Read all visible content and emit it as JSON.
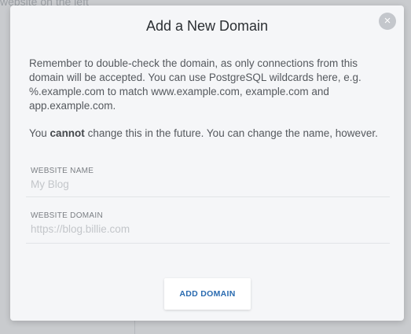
{
  "background": {
    "text": "website on the left"
  },
  "modal": {
    "title": "Add a New Domain",
    "close_icon": "×",
    "paragraph1": "Remember to double-check the domain, as only connections from this domain will be accepted. You can use PostgreSQL wildcards here, e.g. %.example.com to match www.example.com, example.com and app.example.com.",
    "paragraph2_before": "You ",
    "paragraph2_bold": "cannot",
    "paragraph2_after": " change this in the future. You can change the name, however.",
    "fields": [
      {
        "label": "WEBSITE NAME",
        "value": "",
        "placeholder": "My Blog"
      },
      {
        "label": "WEBSITE DOMAIN",
        "value": "",
        "placeholder": "https://blog.billie.com"
      }
    ],
    "submit_label": "ADD DOMAIN"
  },
  "colors": {
    "accent": "#2a6bb0",
    "modal_bg": "#f5f6f8",
    "backdrop": "#c9cbce"
  }
}
